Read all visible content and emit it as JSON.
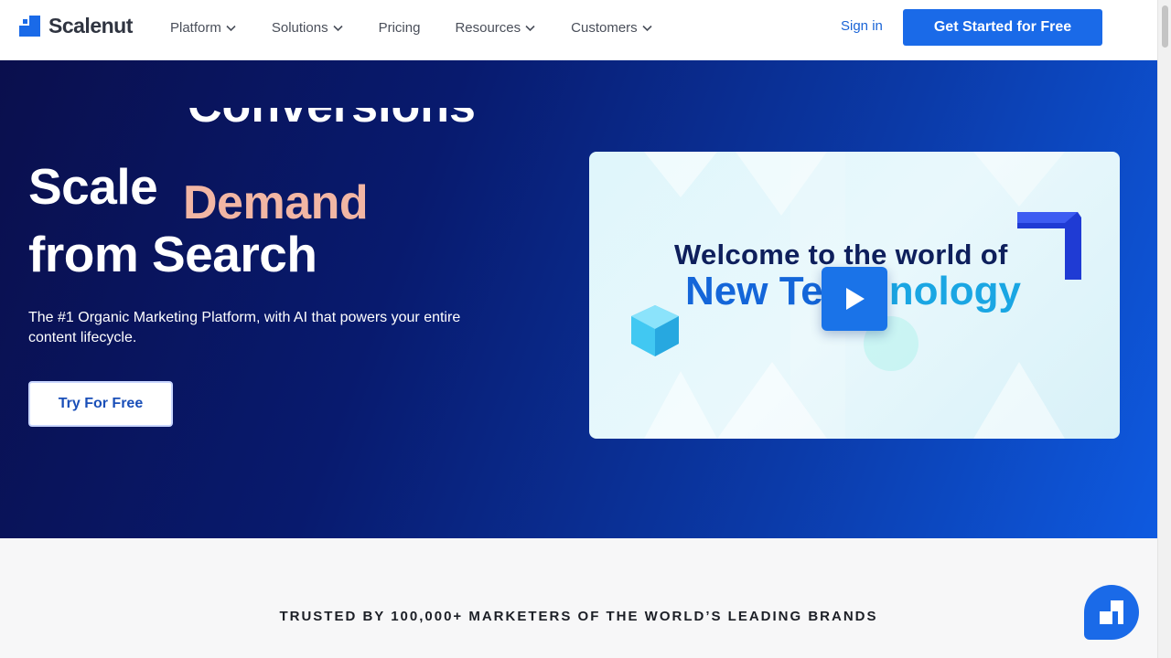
{
  "brand": {
    "name": "Scalenut",
    "color": "#1a6ae8"
  },
  "nav": {
    "items": [
      {
        "label": "Platform",
        "has_dropdown": true
      },
      {
        "label": "Solutions",
        "has_dropdown": true
      },
      {
        "label": "Pricing",
        "has_dropdown": false
      },
      {
        "label": "Resources",
        "has_dropdown": true
      },
      {
        "label": "Customers",
        "has_dropdown": true
      }
    ],
    "signin_label": "Sign in",
    "cta_label": "Get Started for Free"
  },
  "hero": {
    "rotating_word_previous": "Conversions",
    "headline_line1": "Scale",
    "headline_accent": "Demand",
    "headline_line2": "from Search",
    "subtitle": "The #1 Organic Marketing Platform, with AI that powers your entire content lifecycle.",
    "try_button_label": "Try For Free",
    "accent_color": "#f2b6a4"
  },
  "video": {
    "line1": "Welcome to the world of",
    "line2_start": "New Te",
    "line2_end": "nology",
    "play_icon": "play-icon"
  },
  "trusted": {
    "text": "TRUSTED BY 100,000+ MARKETERS OF THE WORLD’S LEADING BRANDS"
  },
  "chat": {
    "icon": "chat-widget-icon"
  }
}
